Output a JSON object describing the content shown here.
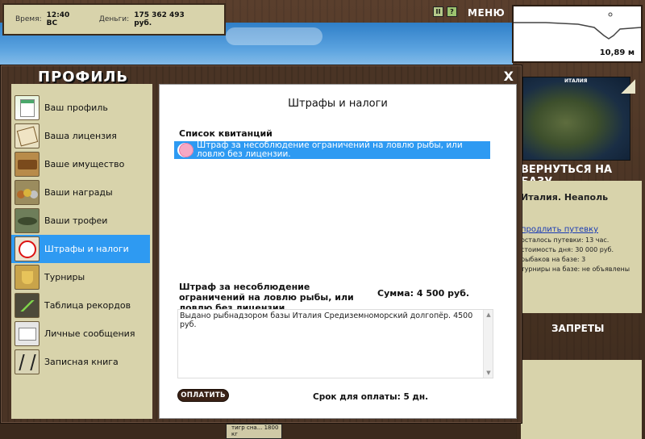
{
  "hud": {
    "time_label": "Время:",
    "time_value": "12:40 ВС",
    "money_label": "Деньги:",
    "money_value": "175 362 493 руб.",
    "pause_icon": "pause-icon",
    "help_icon": "question-icon",
    "menu_label": "МЕНЮ"
  },
  "depth": {
    "value": "10,89 м"
  },
  "map": {
    "title": "ИТАЛИЯ"
  },
  "base_panel": {
    "return_label": "ВЕРНУТЬСЯ НА БАЗУ",
    "location": "Италия. Неаполь",
    "extend_link": "продлить путевку",
    "days_left": "осталось путевки: 13 час.",
    "day_cost": "стоимость дня: 30 000 руб.",
    "fishers": "рыбаков на базе: 3",
    "tournaments": "турниры на базе: не объявлены"
  },
  "bans_title": "ЗАПРЕТЫ",
  "bottom_slot_text": "тигр сна... 1800 кг",
  "window": {
    "title": "ПРОФИЛЬ",
    "close_label": "X"
  },
  "sidebar": {
    "items": [
      {
        "label": "Ваш профиль",
        "icon": "profile-icon"
      },
      {
        "label": "Ваша лицензия",
        "icon": "license-icon"
      },
      {
        "label": "Ваше имущество",
        "icon": "property-icon"
      },
      {
        "label": "Ваши награды",
        "icon": "awards-icon"
      },
      {
        "label": "Ваши трофеи",
        "icon": "trophy-fish-icon"
      },
      {
        "label": "Штрафы и налоги",
        "icon": "fines-icon",
        "active": true
      },
      {
        "label": "Турниры",
        "icon": "tournament-cup-icon"
      },
      {
        "label": "Таблица рекордов",
        "icon": "records-chart-icon"
      },
      {
        "label": "Личные сообщения",
        "icon": "envelope-icon"
      },
      {
        "label": "Записная книга",
        "icon": "notebook-icon"
      }
    ]
  },
  "content": {
    "title": "Штрафы и налоги",
    "receipts_heading": "Список квитанций",
    "receipts": [
      {
        "text": "Штраф за несоблюдение ограничений на ловлю рыбы, или ловлю без лицензии.",
        "icon": "piggy-bank-icon",
        "selected": true
      }
    ],
    "detail": {
      "title": "Штраф за несоблюдение ограничений на ловлю рыбы, или ловлю без лицензии.",
      "amount": "Сумма: 4 500 руб.",
      "text": "Выдано рыбнадзором базы Италия Средиземноморский долгопёр. 4500 руб."
    },
    "pay_button": "ОПЛАТИТЬ",
    "deadline": "Срок для оплаты: 5 дн."
  }
}
